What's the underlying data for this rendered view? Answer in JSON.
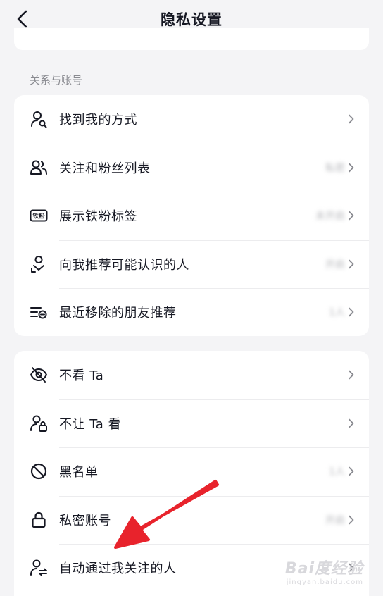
{
  "header": {
    "title": "隐私设置",
    "back_icon": "chevron-left-icon"
  },
  "sections": {
    "relationship_label": "关系与账号"
  },
  "group1": [
    {
      "label": "找到我的方式",
      "value": "",
      "icon": "person-search-icon"
    },
    {
      "label": "关注和粉丝列表",
      "value": "私密",
      "icon": "people-icon"
    },
    {
      "label": "展示铁粉标签",
      "value": "未开启",
      "icon": "fan-badge-icon"
    },
    {
      "label": "向我推荐可能认识的人",
      "value": "开启",
      "icon": "person-recommend-icon"
    },
    {
      "label": "最近移除的朋友推荐",
      "value": "1人",
      "icon": "list-remove-icon"
    }
  ],
  "group2": [
    {
      "label": "不看 Ta",
      "value": "",
      "icon": "eye-off-icon"
    },
    {
      "label": "不让 Ta 看",
      "value": "",
      "icon": "person-lock-icon"
    },
    {
      "label": "黑名单",
      "value": "1人",
      "icon": "block-icon"
    },
    {
      "label": "私密账号",
      "value": "开启",
      "icon": "lock-icon"
    },
    {
      "label": "自动通过我关注的人",
      "value": "",
      "icon": "person-auto-accept-icon"
    }
  ],
  "annotation": {
    "arrow_color": "#e8232c"
  },
  "watermark": {
    "main": "Bai度经验",
    "sub": "jingyan.baidu.com"
  }
}
